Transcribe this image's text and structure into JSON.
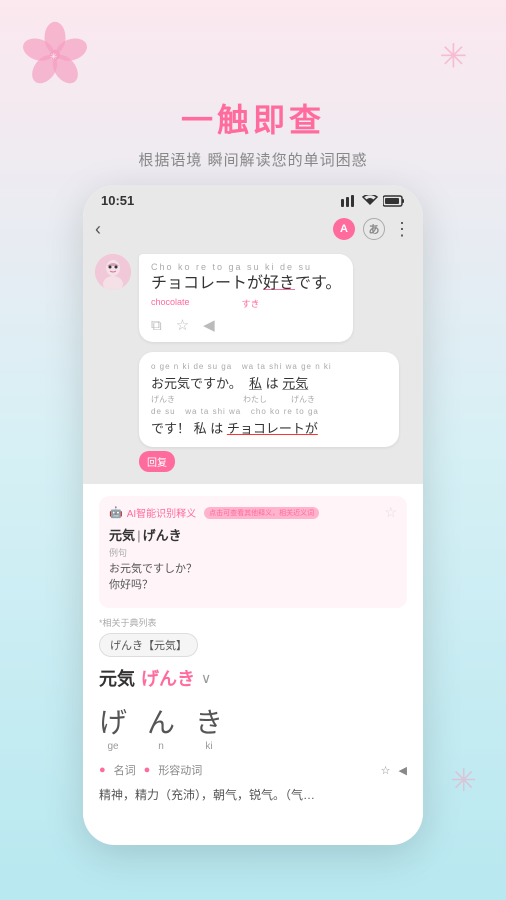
{
  "background": {
    "gradient_start": "#fce8ef",
    "gradient_end": "#b8e8f0"
  },
  "header": {
    "main_title": "一触即查",
    "sub_title": "根据语境 瞬间解读您的单词困惑"
  },
  "phone": {
    "status_bar": {
      "time": "10:51",
      "signal": "▼▲",
      "battery": "▌"
    },
    "app_bar": {
      "back_icon": "‹",
      "lang_a": "A",
      "lang_jp": "あ",
      "more_icon": "⋮"
    },
    "chat": {
      "bubble1": {
        "reading": "Cho ko re to ga su ki de su",
        "text_line1": "チョコレートが好きです。",
        "underline_word": "好き",
        "meaning_chocolate": "chocolate",
        "meaning_suki": "すき",
        "actions": [
          "copy",
          "star",
          "speaker"
        ]
      },
      "bubble2": {
        "reading1": "o ge n ki de su ga  wa ta shi wa ge n ki",
        "line1_parts": [
          "お元気ですか。",
          "私",
          "は",
          "元気"
        ],
        "line1_readings": [
          "げんき",
          "わたし",
          "",
          "げんき"
        ],
        "reading2": "de su wa ta shi wa cho ko re to ga",
        "line2_parts": [
          "です！",
          "私",
          "は",
          "チョコレートが"
        ],
        "reply_label": "回复"
      }
    },
    "dict_panel": {
      "ai_label": "AI智能识别释义",
      "ai_badge_text": "点击可查看其他释义，相关近义词",
      "word_entry": "元気|げんき",
      "example_label": "例句",
      "example": "お元気ですしか？",
      "example_translation": "你好吗？",
      "related_label": "*相关于典列表",
      "related_tag": "げんき【元気】",
      "word_kanji": "元気",
      "word_kana": "げんき",
      "kana_breakdown": [
        {
          "char": "げ",
          "roma": "ge"
        },
        {
          "char": "ん",
          "roma": "n"
        },
        {
          "char": "き",
          "roma": "ki"
        }
      ],
      "pos1": "名词",
      "pos2": "形容动词",
      "definition": "精神，精力（充沛），朝气，锐气。（气…",
      "star_icon": "☆",
      "speaker_icon": "◀"
    }
  }
}
